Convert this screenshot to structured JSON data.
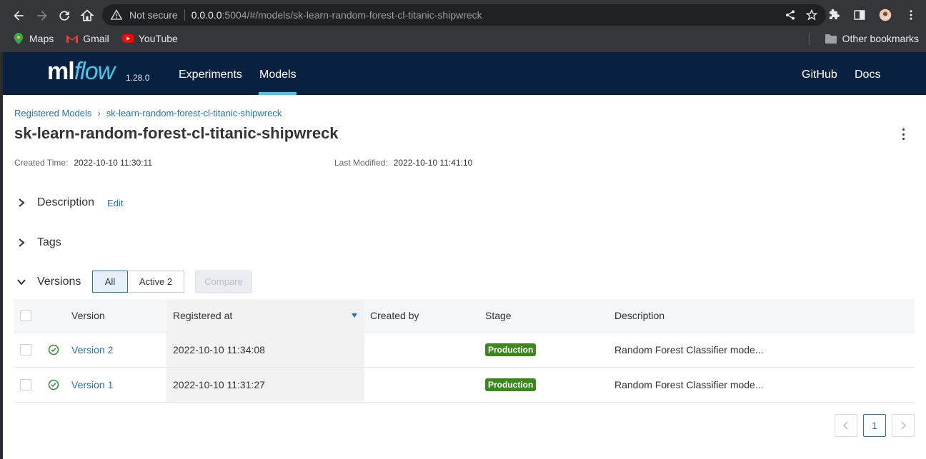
{
  "browser": {
    "not_secure": "Not secure",
    "url_host": "0.0.0.0",
    "url_path": ":5004/#/models/sk-learn-random-forest-cl-titanic-shipwreck",
    "bookmarks": [
      {
        "label": "Maps",
        "icon": "maps-pin-icon"
      },
      {
        "label": "Gmail",
        "icon": "gmail-icon"
      },
      {
        "label": "YouTube",
        "icon": "youtube-icon"
      }
    ],
    "other_bookmarks": "Other bookmarks"
  },
  "app": {
    "logo_ml": "ml",
    "logo_flow": "flow",
    "version": "1.28.0",
    "nav": {
      "experiments": "Experiments",
      "models": "Models",
      "github": "GitHub",
      "docs": "Docs"
    },
    "colors": {
      "header_bg": "#082140",
      "accent": "#43c9ed",
      "link": "#2374bb",
      "production": "#3a8a1a"
    }
  },
  "breadcrumb": {
    "root": "Registered Models",
    "current": "sk-learn-random-forest-cl-titanic-shipwreck"
  },
  "model": {
    "title": "sk-learn-random-forest-cl-titanic-shipwreck",
    "created_label": "Created Time:",
    "created_value": "2022-10-10 11:30:11",
    "modified_label": "Last Modified:",
    "modified_value": "2022-10-10 11:41:10"
  },
  "sections": {
    "description": "Description",
    "edit": "Edit",
    "tags": "Tags",
    "versions": "Versions"
  },
  "filters": {
    "all": "All",
    "active": "Active 2",
    "compare": "Compare"
  },
  "table": {
    "headers": {
      "version": "Version",
      "registered_at": "Registered at",
      "created_by": "Created by",
      "stage": "Stage",
      "description": "Description"
    },
    "rows": [
      {
        "version": "Version 2",
        "registered_at": "2022-10-10 11:34:08",
        "created_by": "",
        "stage": "Production",
        "description": "Random Forest Classifier mode..."
      },
      {
        "version": "Version 1",
        "registered_at": "2022-10-10 11:31:27",
        "created_by": "",
        "stage": "Production",
        "description": "Random Forest Classifier mode..."
      }
    ]
  },
  "pagination": {
    "current": "1"
  }
}
